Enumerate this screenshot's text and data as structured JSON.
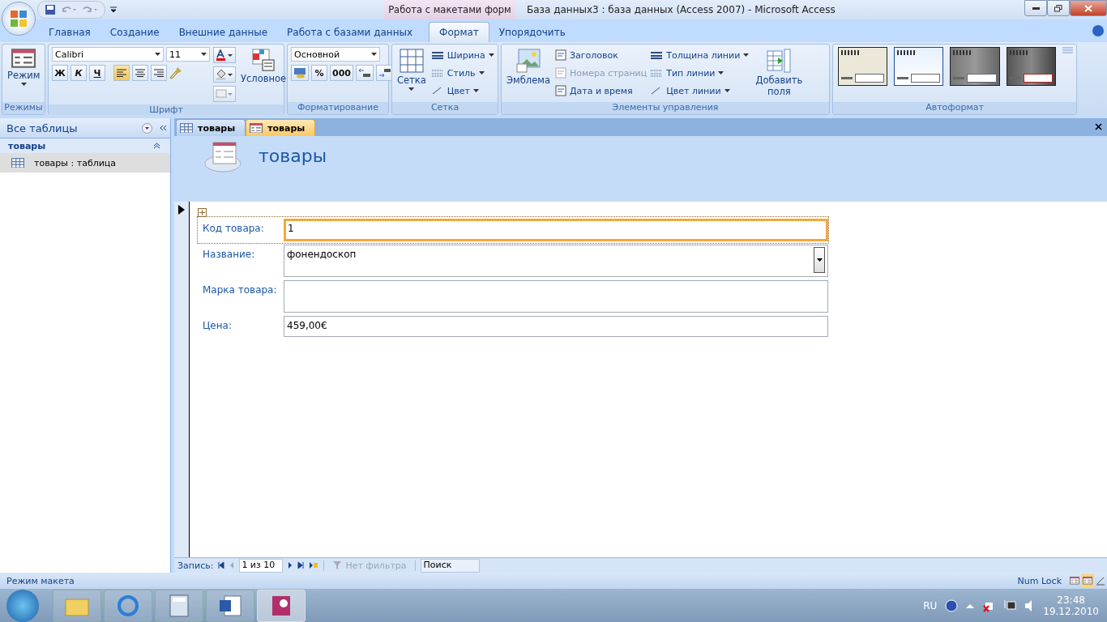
{
  "window": {
    "title": "База данных3 : база данных (Access 2007)  -  Microsoft Access",
    "context_tab": "Работа с макетами форм"
  },
  "ribbon_tabs": [
    {
      "label": "Главная",
      "selected": false
    },
    {
      "label": "Создание",
      "selected": false
    },
    {
      "label": "Внешние данные",
      "selected": false
    },
    {
      "label": "Работа с базами данных",
      "selected": false
    },
    {
      "label": "Формат",
      "selected": true
    },
    {
      "label": "Упорядочить",
      "selected": false
    }
  ],
  "ribbon_groups": [
    {
      "kind": "mode",
      "name": "Режимы",
      "button": "Режим"
    },
    {
      "kind": "font",
      "name": "Шрифт",
      "font_name": "Calibri",
      "font_size": "11",
      "styles": [
        "Ж",
        "К",
        "Ч"
      ],
      "align": [
        {
          "selected": true
        },
        {
          "selected": false
        },
        {
          "selected": false
        }
      ],
      "conditional": "Условное"
    },
    {
      "kind": "formatting",
      "name": "Форматирование",
      "format": "Основной",
      "buttons": [
        "%",
        "000"
      ]
    },
    {
      "kind": "grid",
      "name": "Сетка",
      "button": "Сетка",
      "items": [
        "Ширина",
        "Стиль",
        "Цвет"
      ]
    },
    {
      "kind": "controls",
      "name": "Элементы управления",
      "button": "Эмблема",
      "items": [
        {
          "label": "Заголовок",
          "disabled": false
        },
        {
          "label": "Номера страниц",
          "disabled": true
        },
        {
          "label": "Дата и время",
          "disabled": false
        }
      ],
      "line_items": [
        "Толщина линии",
        "Тип линии",
        "Цвет линии"
      ],
      "add_fields": "Добавить поля"
    },
    {
      "kind": "autoformat",
      "name": "Автоформат",
      "styles": [
        {
          "selected": false
        },
        {
          "selected": true
        },
        {
          "selected": false
        },
        {
          "selected": false
        }
      ]
    }
  ],
  "nav_pane": {
    "title": "Все таблицы",
    "group": "товары",
    "items": [
      {
        "label": "товары : таблица",
        "selected": true
      }
    ]
  },
  "doc_tabs": [
    {
      "label": "товары",
      "kind": "table",
      "selected": false
    },
    {
      "label": "товары",
      "kind": "form",
      "selected": true
    }
  ],
  "form": {
    "title": "товары",
    "fields": [
      {
        "label": "Код товара:",
        "value": "1",
        "kind": "text",
        "selected": true
      },
      {
        "label": "Название:",
        "value": "фонендоскоп",
        "kind": "combo",
        "selected": false
      },
      {
        "label": "Марка товара:",
        "kind": "memo",
        "selected": false
      },
      {
        "label": "Цена:",
        "value": "459,00€",
        "kind": "text",
        "selected": false
      }
    ]
  },
  "record_nav": {
    "label": "Запись:",
    "position": "1 из 10",
    "filter": "Нет фильтра",
    "search": "Поиск"
  },
  "status_bar": {
    "mode": "Режим макета",
    "num_lock": "Num Lock",
    "views": [
      {
        "selected": false
      },
      {
        "selected": true
      },
      {
        "selected": false
      }
    ]
  },
  "taskbar": {
    "apps": [
      {
        "selected": false
      },
      {
        "selected": false
      },
      {
        "selected": false
      },
      {
        "selected": false
      },
      {
        "selected": true
      }
    ],
    "language": "RU",
    "time": "23:48",
    "date": "19.12.2010"
  }
}
